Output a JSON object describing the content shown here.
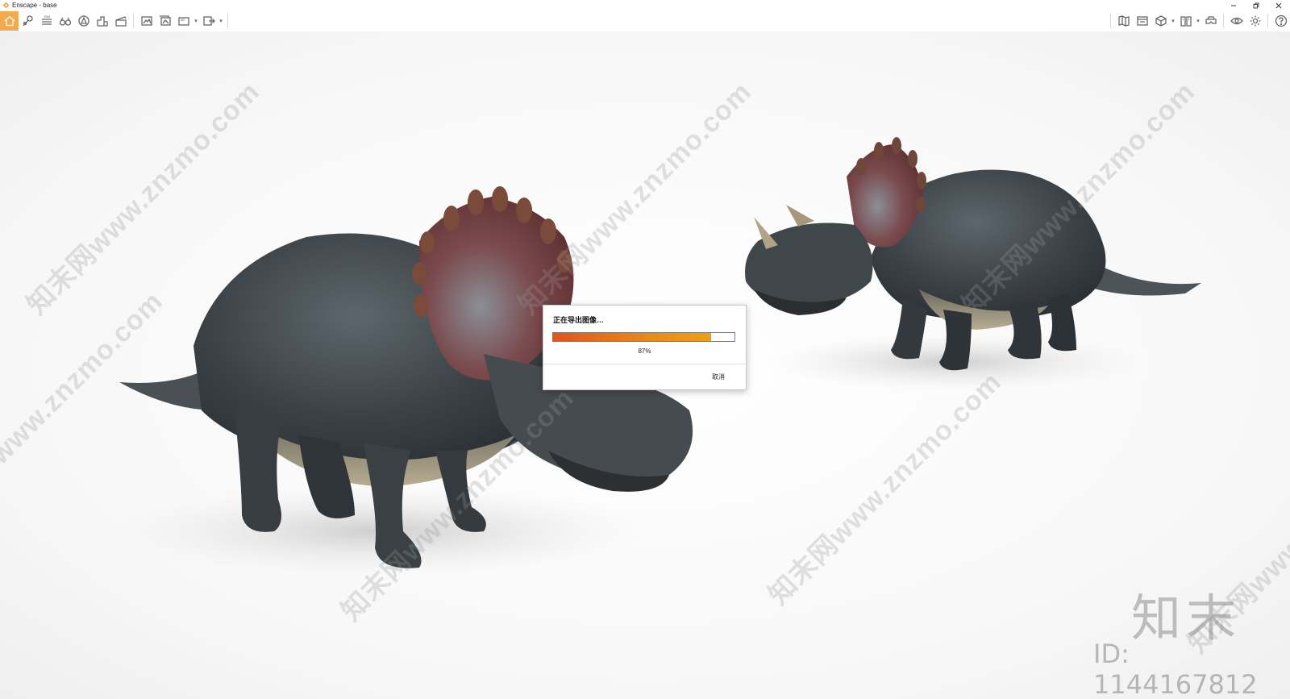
{
  "window": {
    "title": "Enscape - base",
    "controls": [
      "minimize",
      "restore",
      "close"
    ]
  },
  "toolbar": {
    "left_icons": [
      {
        "name": "home-icon",
        "active": true
      },
      {
        "name": "visual-settings-icon"
      },
      {
        "name": "bim-icon"
      },
      {
        "name": "binoculars-icon"
      },
      {
        "name": "asset-library-icon"
      },
      {
        "name": "building-icon"
      },
      {
        "name": "clapboard-icon"
      },
      {
        "name": "screenshot-icon"
      },
      {
        "name": "batch-render-icon"
      },
      {
        "name": "panorama-360-icon",
        "dropdown": true
      },
      {
        "name": "export-icon",
        "dropdown": true
      }
    ],
    "right_icons": [
      {
        "name": "map-icon"
      },
      {
        "name": "window-icon"
      },
      {
        "name": "cube-icon",
        "dropdown": true
      },
      {
        "name": "book-icon",
        "dropdown": true
      },
      {
        "name": "vr-headset-icon"
      },
      {
        "name": "eye-icon"
      },
      {
        "name": "gear-icon"
      },
      {
        "name": "help-icon"
      }
    ]
  },
  "dialog": {
    "title": "正在导出图像…",
    "progress": 87,
    "progress_text": "87%",
    "cancel_label": "取消"
  },
  "watermarks": {
    "site_text": "知末网www.znzmo.com",
    "brand_mark": "知末",
    "brand_id": "ID: 1144167812"
  },
  "colors": {
    "active_tab": "#f3a94f",
    "progress_start": "#e2541c",
    "progress_end": "#eea015"
  }
}
